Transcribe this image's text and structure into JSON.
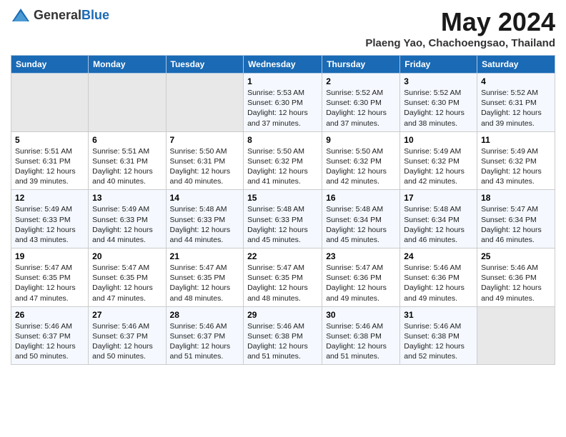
{
  "header": {
    "logo_general": "General",
    "logo_blue": "Blue",
    "title": "May 2024",
    "subtitle": "Plaeng Yao, Chachoengsao, Thailand"
  },
  "calendar": {
    "weekdays": [
      "Sunday",
      "Monday",
      "Tuesday",
      "Wednesday",
      "Thursday",
      "Friday",
      "Saturday"
    ],
    "weeks": [
      [
        {
          "day": "",
          "content": ""
        },
        {
          "day": "",
          "content": ""
        },
        {
          "day": "",
          "content": ""
        },
        {
          "day": "1",
          "content": "Sunrise: 5:53 AM\nSunset: 6:30 PM\nDaylight: 12 hours\nand 37 minutes."
        },
        {
          "day": "2",
          "content": "Sunrise: 5:52 AM\nSunset: 6:30 PM\nDaylight: 12 hours\nand 37 minutes."
        },
        {
          "day": "3",
          "content": "Sunrise: 5:52 AM\nSunset: 6:30 PM\nDaylight: 12 hours\nand 38 minutes."
        },
        {
          "day": "4",
          "content": "Sunrise: 5:52 AM\nSunset: 6:31 PM\nDaylight: 12 hours\nand 39 minutes."
        }
      ],
      [
        {
          "day": "5",
          "content": "Sunrise: 5:51 AM\nSunset: 6:31 PM\nDaylight: 12 hours\nand 39 minutes."
        },
        {
          "day": "6",
          "content": "Sunrise: 5:51 AM\nSunset: 6:31 PM\nDaylight: 12 hours\nand 40 minutes."
        },
        {
          "day": "7",
          "content": "Sunrise: 5:50 AM\nSunset: 6:31 PM\nDaylight: 12 hours\nand 40 minutes."
        },
        {
          "day": "8",
          "content": "Sunrise: 5:50 AM\nSunset: 6:32 PM\nDaylight: 12 hours\nand 41 minutes."
        },
        {
          "day": "9",
          "content": "Sunrise: 5:50 AM\nSunset: 6:32 PM\nDaylight: 12 hours\nand 42 minutes."
        },
        {
          "day": "10",
          "content": "Sunrise: 5:49 AM\nSunset: 6:32 PM\nDaylight: 12 hours\nand 42 minutes."
        },
        {
          "day": "11",
          "content": "Sunrise: 5:49 AM\nSunset: 6:32 PM\nDaylight: 12 hours\nand 43 minutes."
        }
      ],
      [
        {
          "day": "12",
          "content": "Sunrise: 5:49 AM\nSunset: 6:33 PM\nDaylight: 12 hours\nand 43 minutes."
        },
        {
          "day": "13",
          "content": "Sunrise: 5:49 AM\nSunset: 6:33 PM\nDaylight: 12 hours\nand 44 minutes."
        },
        {
          "day": "14",
          "content": "Sunrise: 5:48 AM\nSunset: 6:33 PM\nDaylight: 12 hours\nand 44 minutes."
        },
        {
          "day": "15",
          "content": "Sunrise: 5:48 AM\nSunset: 6:33 PM\nDaylight: 12 hours\nand 45 minutes."
        },
        {
          "day": "16",
          "content": "Sunrise: 5:48 AM\nSunset: 6:34 PM\nDaylight: 12 hours\nand 45 minutes."
        },
        {
          "day": "17",
          "content": "Sunrise: 5:48 AM\nSunset: 6:34 PM\nDaylight: 12 hours\nand 46 minutes."
        },
        {
          "day": "18",
          "content": "Sunrise: 5:47 AM\nSunset: 6:34 PM\nDaylight: 12 hours\nand 46 minutes."
        }
      ],
      [
        {
          "day": "19",
          "content": "Sunrise: 5:47 AM\nSunset: 6:35 PM\nDaylight: 12 hours\nand 47 minutes."
        },
        {
          "day": "20",
          "content": "Sunrise: 5:47 AM\nSunset: 6:35 PM\nDaylight: 12 hours\nand 47 minutes."
        },
        {
          "day": "21",
          "content": "Sunrise: 5:47 AM\nSunset: 6:35 PM\nDaylight: 12 hours\nand 48 minutes."
        },
        {
          "day": "22",
          "content": "Sunrise: 5:47 AM\nSunset: 6:35 PM\nDaylight: 12 hours\nand 48 minutes."
        },
        {
          "day": "23",
          "content": "Sunrise: 5:47 AM\nSunset: 6:36 PM\nDaylight: 12 hours\nand 49 minutes."
        },
        {
          "day": "24",
          "content": "Sunrise: 5:46 AM\nSunset: 6:36 PM\nDaylight: 12 hours\nand 49 minutes."
        },
        {
          "day": "25",
          "content": "Sunrise: 5:46 AM\nSunset: 6:36 PM\nDaylight: 12 hours\nand 49 minutes."
        }
      ],
      [
        {
          "day": "26",
          "content": "Sunrise: 5:46 AM\nSunset: 6:37 PM\nDaylight: 12 hours\nand 50 minutes."
        },
        {
          "day": "27",
          "content": "Sunrise: 5:46 AM\nSunset: 6:37 PM\nDaylight: 12 hours\nand 50 minutes."
        },
        {
          "day": "28",
          "content": "Sunrise: 5:46 AM\nSunset: 6:37 PM\nDaylight: 12 hours\nand 51 minutes."
        },
        {
          "day": "29",
          "content": "Sunrise: 5:46 AM\nSunset: 6:38 PM\nDaylight: 12 hours\nand 51 minutes."
        },
        {
          "day": "30",
          "content": "Sunrise: 5:46 AM\nSunset: 6:38 PM\nDaylight: 12 hours\nand 51 minutes."
        },
        {
          "day": "31",
          "content": "Sunrise: 5:46 AM\nSunset: 6:38 PM\nDaylight: 12 hours\nand 52 minutes."
        },
        {
          "day": "",
          "content": ""
        }
      ]
    ]
  }
}
